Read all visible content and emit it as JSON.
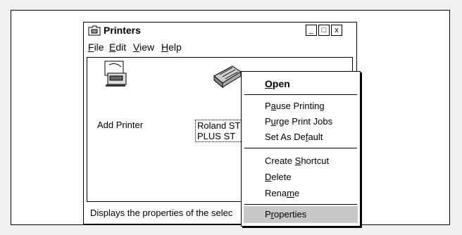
{
  "window": {
    "title": "Printers",
    "controls": {
      "minimize": "_",
      "maximize": "□",
      "close": "x"
    }
  },
  "menu": [
    {
      "label": "File",
      "mnemonic": "F"
    },
    {
      "label": "Edit",
      "mnemonic": "E"
    },
    {
      "label": "View",
      "mnemonic": "V"
    },
    {
      "label": "Help",
      "mnemonic": "H"
    }
  ],
  "items": {
    "add_printer": {
      "label": "Add Printer",
      "icon": "add-printer-icon"
    },
    "roland": {
      "label_line1": "Roland ST",
      "label_line2": "PLUS ST",
      "icon": "printer-icon"
    }
  },
  "status_bar": {
    "text": "Displays the properties of the selec"
  },
  "context_menu": {
    "open": "Open",
    "pause_printing": "Pause Printing",
    "purge_print_jobs": "Purge Print Jobs",
    "set_as_default": "Set As Default",
    "create_shortcut": "Create Shortcut",
    "delete": "Delete",
    "rename": "Rename",
    "properties": "Properties"
  }
}
